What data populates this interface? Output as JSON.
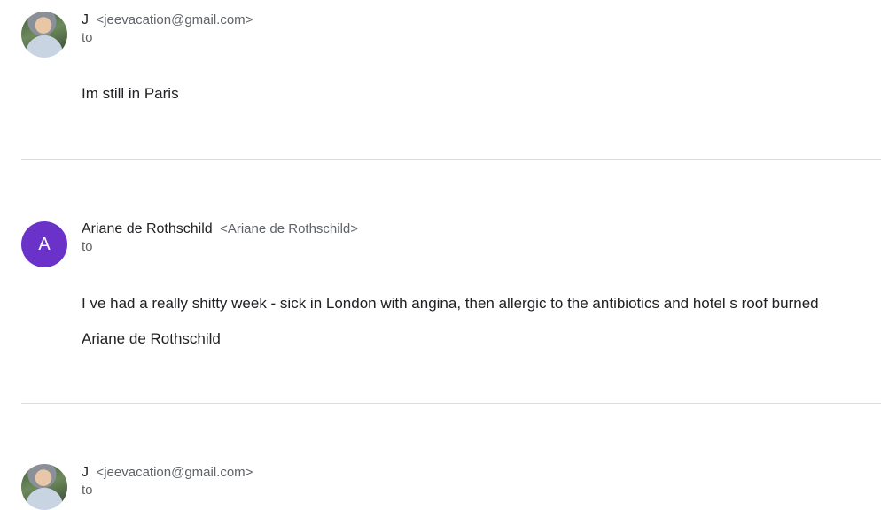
{
  "messages": [
    {
      "sender_name": "J",
      "sender_email": "<jeevacation@gmail.com>",
      "to_label": "to",
      "avatar": "photo-avatar",
      "body": [
        "Im still in Paris"
      ]
    },
    {
      "sender_name": "Ariane de Rothschild",
      "sender_email": "<Ariane de Rothschild>",
      "to_label": "to",
      "avatar_letter": "A",
      "avatar_color": "#6a32c9",
      "body": [
        "I ve had a really shitty week - sick in London with angina, then allergic to the antibiotics and hotel s roof burned",
        "Ariane de Rothschild"
      ]
    },
    {
      "sender_name": "J",
      "sender_email": "<jeevacation@gmail.com>",
      "to_label": "to",
      "avatar": "photo-avatar"
    }
  ]
}
